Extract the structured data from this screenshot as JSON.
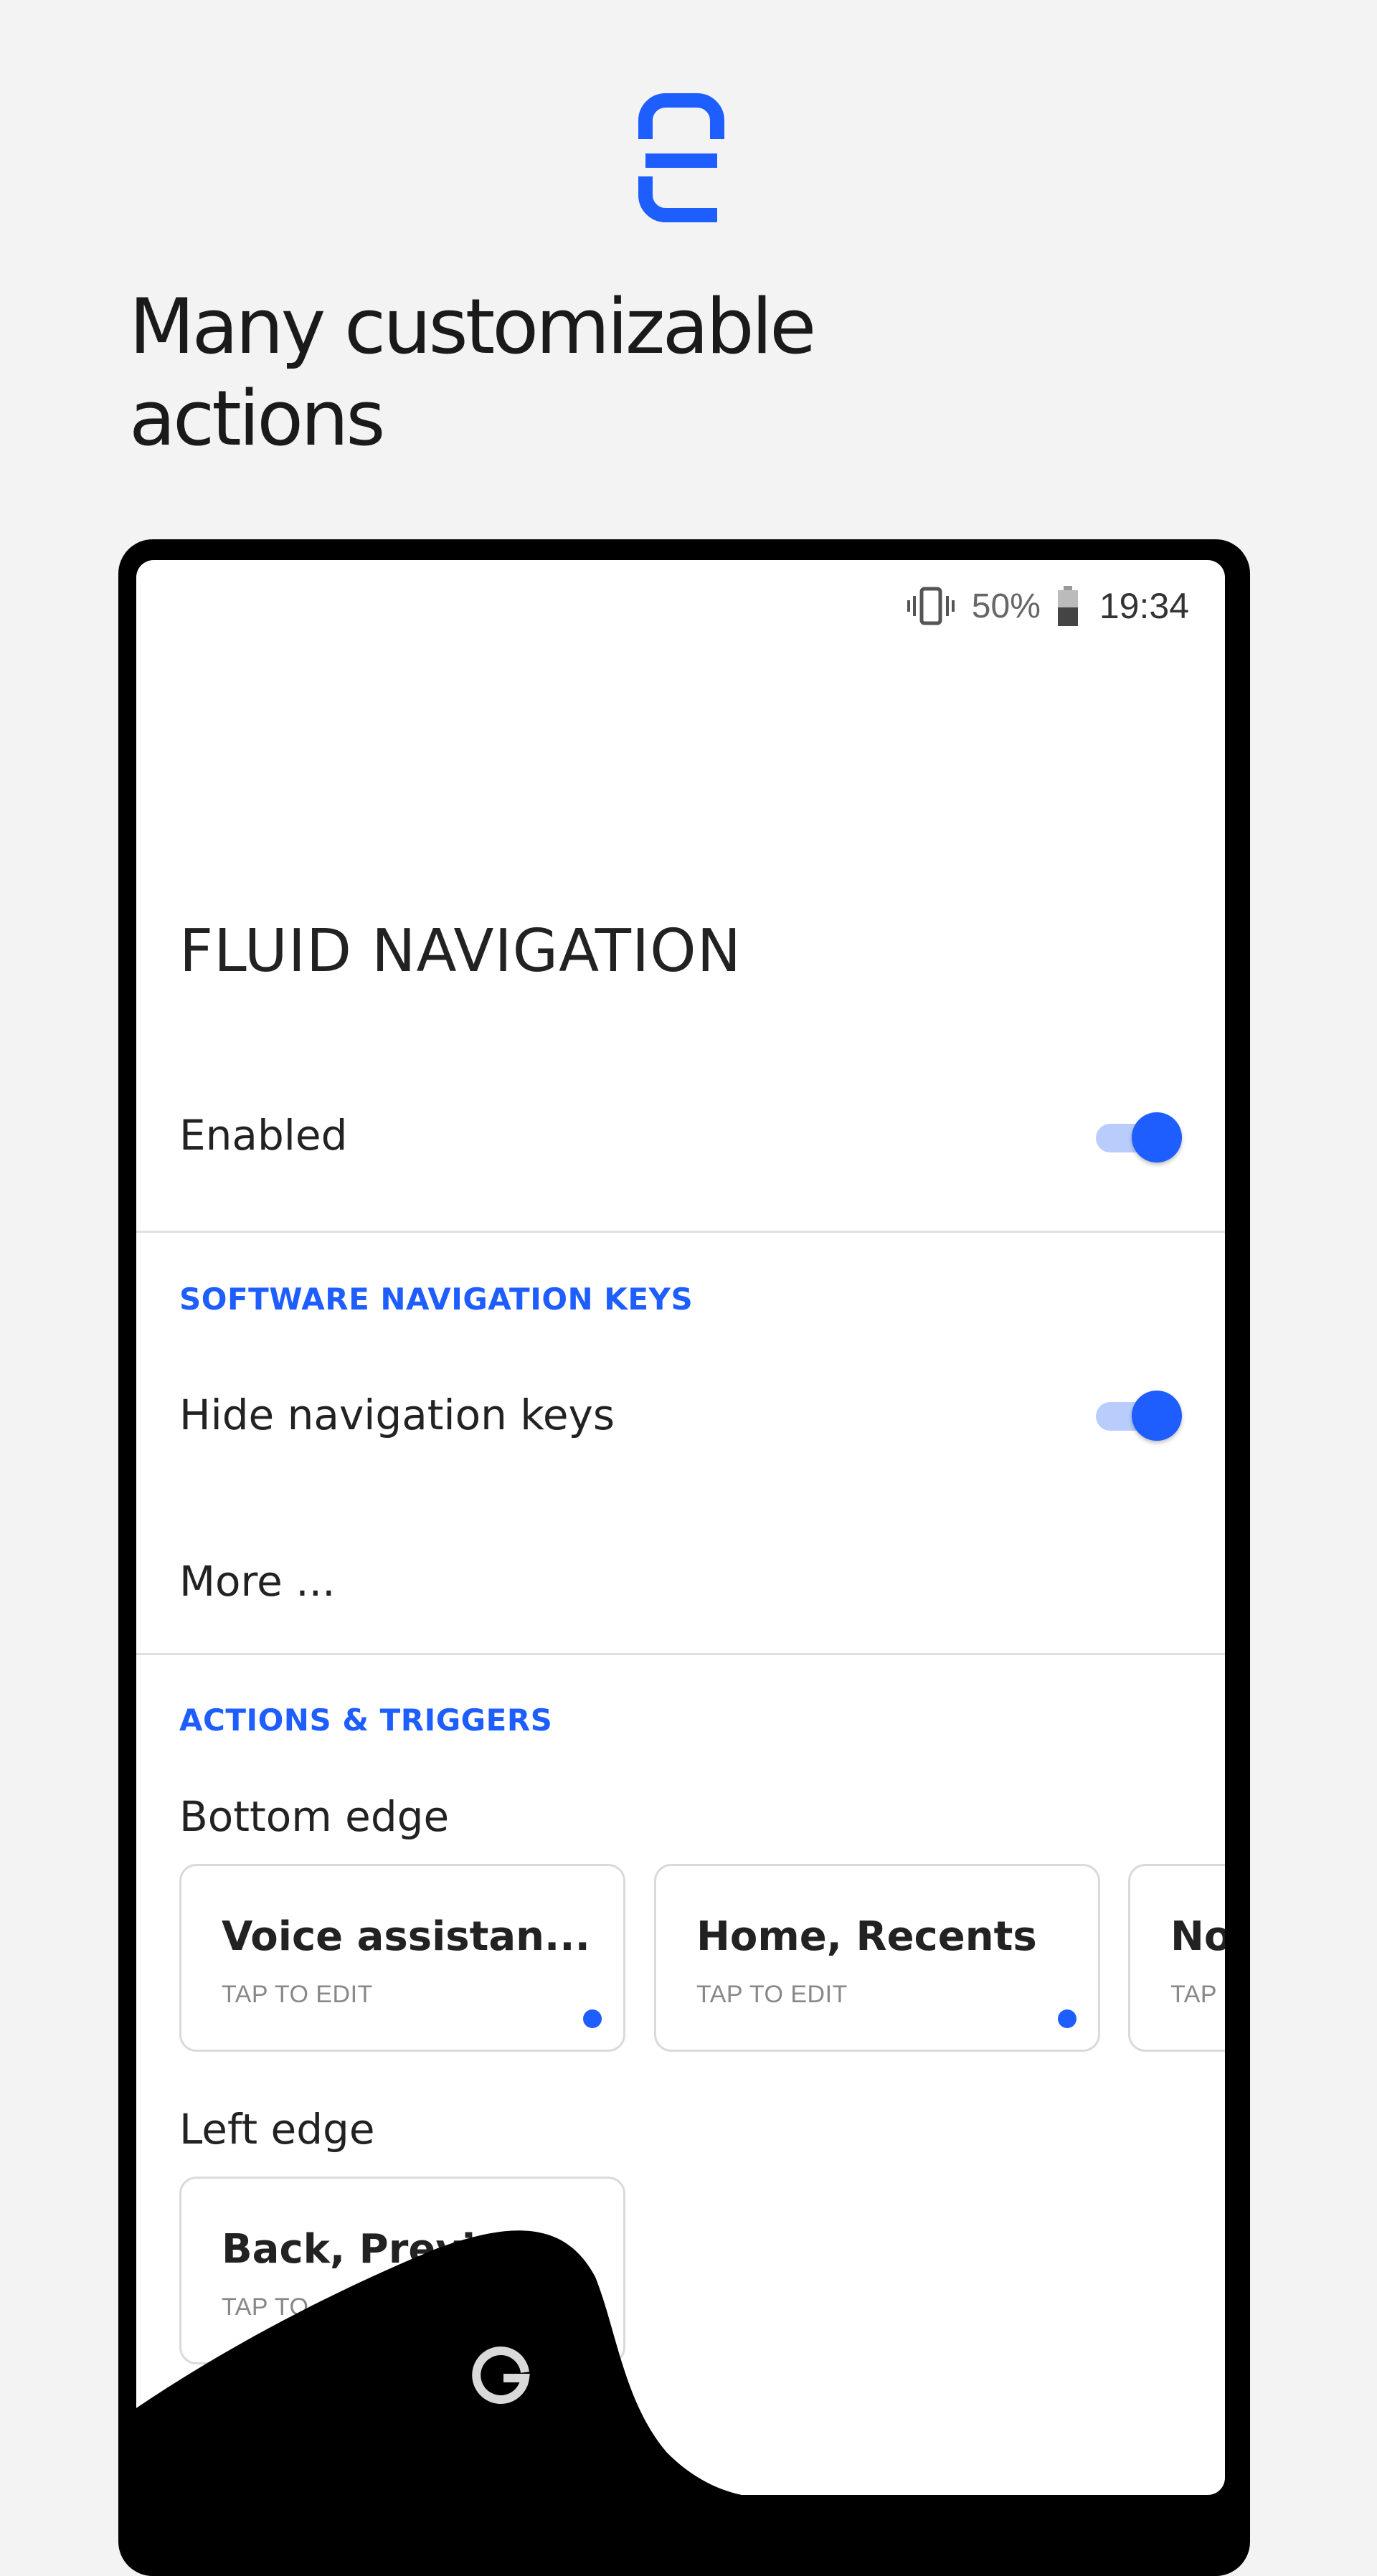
{
  "brand": {
    "logo_icon": "fluid-navigation-logo-icon",
    "accent_color": "#1e5eff"
  },
  "headline": {
    "line1": "Many customizable",
    "line2": "actions"
  },
  "status_bar": {
    "battery_percent": "50%",
    "time": "19:34",
    "vibrate_icon": "vibrate-icon",
    "battery_icon": "battery-icon"
  },
  "app": {
    "title": "FLUID NAVIGATION",
    "enabled_label": "Enabled",
    "enabled_on": true
  },
  "software_keys": {
    "header": "SOFTWARE NAVIGATION KEYS",
    "hide_keys_label": "Hide navigation keys",
    "hide_keys_on": true,
    "more_label": "More ..."
  },
  "actions": {
    "header": "ACTIONS & TRIGGERS",
    "bottom_edge_label": "Bottom edge",
    "bottom_cards": [
      {
        "title": "Voice assistan...",
        "subtitle": "TAP TO EDIT"
      },
      {
        "title": "Home, Recents",
        "subtitle": "TAP TO EDIT"
      },
      {
        "title": "No",
        "subtitle": "TAP"
      }
    ],
    "left_edge_label": "Left edge",
    "left_cards": [
      {
        "title": "Back, Previ",
        "subtitle": "TAP TO"
      }
    ]
  },
  "gesture_overlay": {
    "icon": "google-g-icon"
  }
}
